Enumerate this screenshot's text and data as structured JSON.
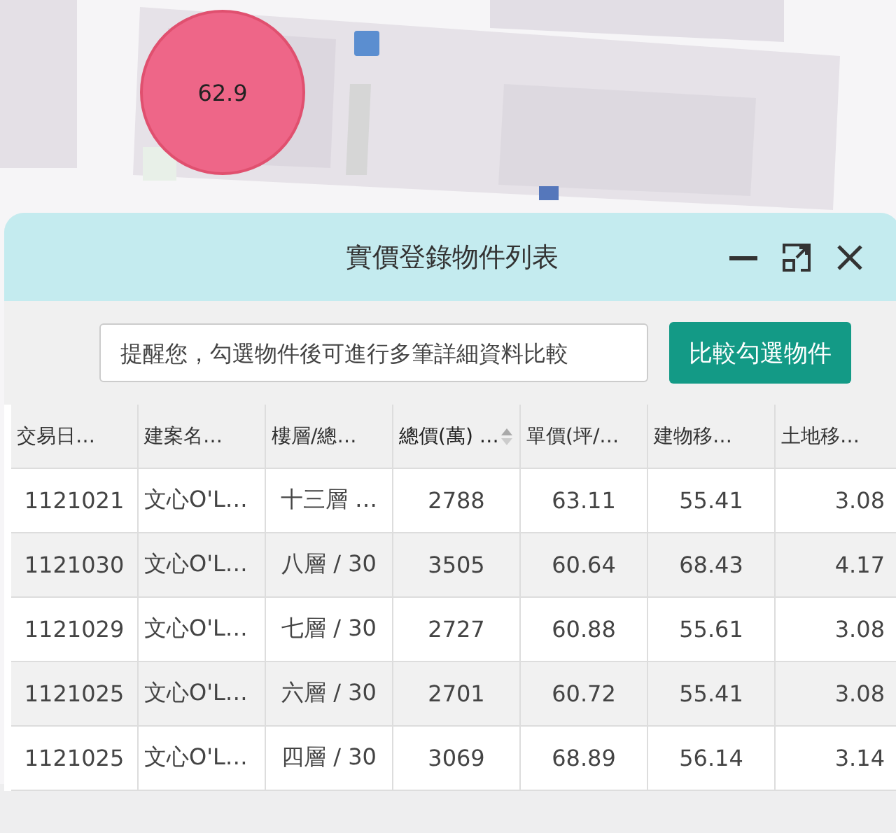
{
  "map": {
    "marker": {
      "label": "62.9",
      "color": "#ee6688"
    }
  },
  "panel": {
    "title": "實價登錄物件列表",
    "search": {
      "placeholder": "提醒您，勾選物件後可進行多筆詳細資料比較"
    },
    "compare_button": "比較勾選物件",
    "table": {
      "columns": [
        {
          "label": "交易日…",
          "sorted": false
        },
        {
          "label": "建案名…",
          "sorted": false
        },
        {
          "label": "樓層/總…",
          "sorted": false
        },
        {
          "label": "總價(萬) …",
          "sorted": true
        },
        {
          "label": "單價(坪/…",
          "sorted": false
        },
        {
          "label": "建物移…",
          "sorted": false
        },
        {
          "label": "土地移…",
          "sorted": false
        }
      ],
      "rows": [
        [
          "1121021",
          "文心O'L…",
          "十三層 …",
          "2788",
          "63.11",
          "55.41",
          "3.08"
        ],
        [
          "1121030",
          "文心O'L…",
          "八層 / 30",
          "3505",
          "60.64",
          "68.43",
          "4.17"
        ],
        [
          "1121029",
          "文心O'L…",
          "七層 / 30",
          "2727",
          "60.88",
          "55.61",
          "3.08"
        ],
        [
          "1121025",
          "文心O'L…",
          "六層 / 30",
          "2701",
          "60.72",
          "55.41",
          "3.08"
        ],
        [
          "1121025",
          "文心O'L…",
          "四層 / 30",
          "3069",
          "68.89",
          "56.14",
          "3.14"
        ]
      ]
    }
  }
}
